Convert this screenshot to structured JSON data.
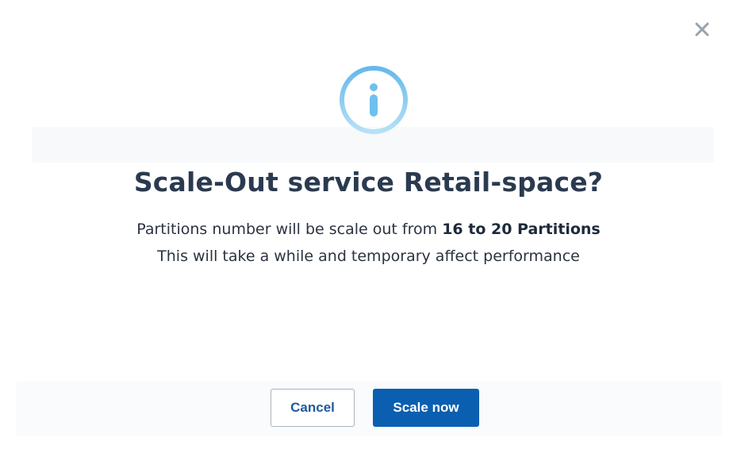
{
  "dialog": {
    "title": "Scale-Out service Retail-space?",
    "message_line1_prefix": "Partitions number will be scale out from ",
    "message_line1_bold": "16 to 20 Partitions",
    "message_line2": "This will take a while and temporary affect performance",
    "cancel_label": "Cancel",
    "confirm_label": "Scale now"
  },
  "icons": {
    "close": "close-icon",
    "info": "info-icon"
  },
  "colors": {
    "primary": "#0b5fb0",
    "title": "#2a3a50",
    "info_ring": "#7cc4ee"
  }
}
